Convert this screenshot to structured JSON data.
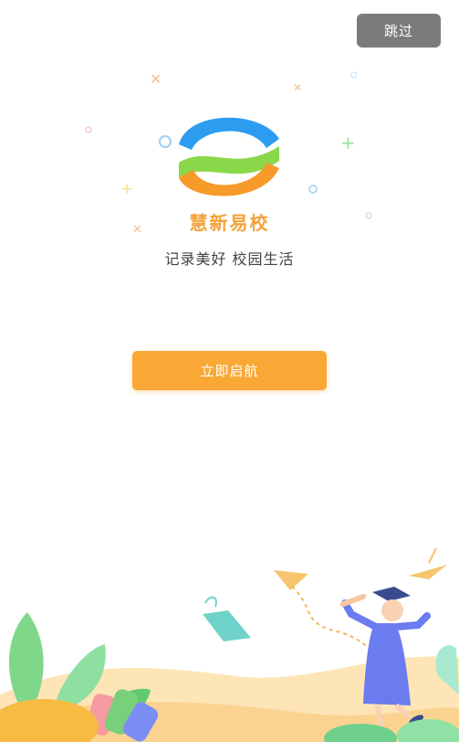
{
  "header": {
    "skip_label": "跳过"
  },
  "brand": {
    "name": "慧新易校",
    "slogan": "记录美好 校园生活"
  },
  "actions": {
    "start_label": "立即启航"
  },
  "colors": {
    "accent": "#f9a835",
    "brand_text": "#f4a23a",
    "skip_bg": "#7b7b7b",
    "logo_blue": "#2c9cf0",
    "logo_green": "#8ad84a",
    "logo_orange": "#f69a2a"
  },
  "icons": {
    "logo": "wave-logo-icon",
    "plane": "paper-plane-icon",
    "graduate": "graduate-icon"
  }
}
